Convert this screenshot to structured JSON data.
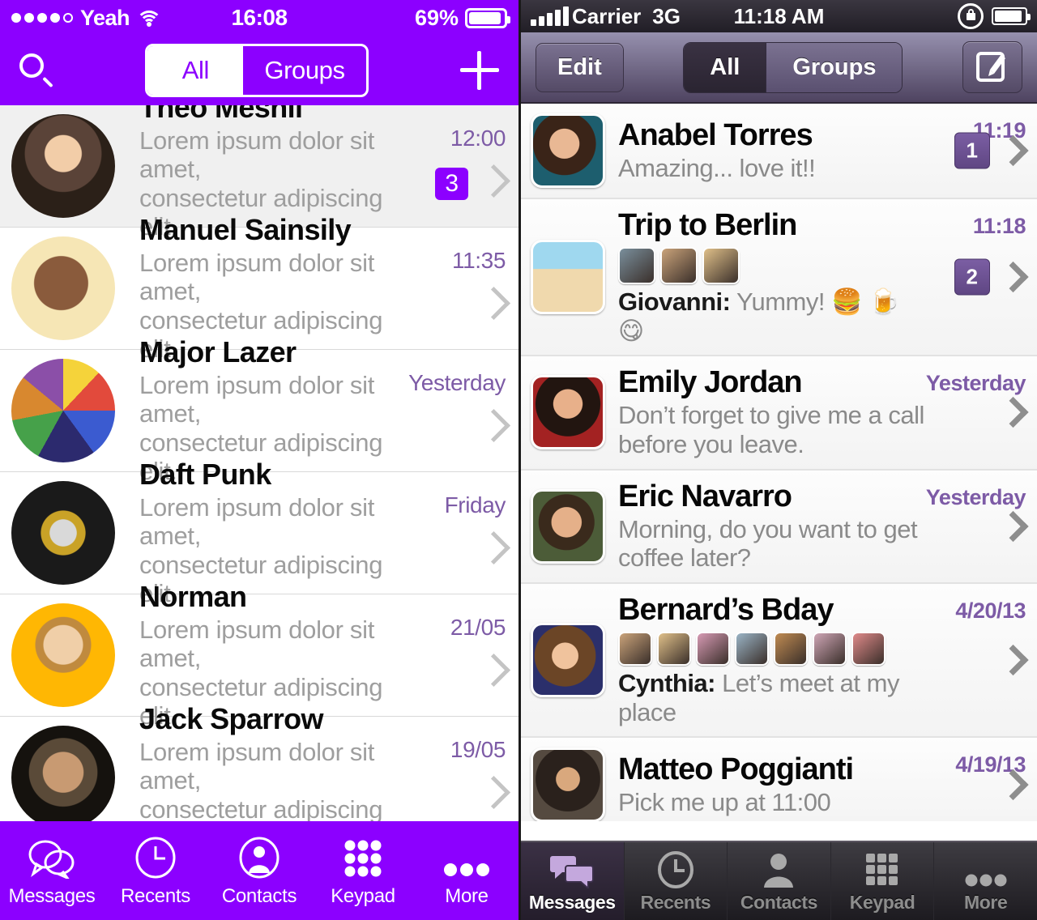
{
  "left_phone": {
    "style_name": "ios7-flat",
    "accent_color": "#8c00ff",
    "timestamp_color": "#7d5ba6",
    "status_bar": {
      "carrier": "Yeah",
      "signal_dots": 5,
      "signal_filled": 4,
      "wifi": "wifi-icon",
      "time": "16:08",
      "battery_percent": "69%"
    },
    "nav": {
      "search_icon": "search-icon",
      "add_icon": "plus-icon",
      "segments": [
        {
          "label": "All",
          "selected": false
        },
        {
          "label": "Groups",
          "selected": true
        }
      ]
    },
    "conversations": [
      {
        "name": "Théo Mesnil",
        "preview_line1": "Lorem ipsum dolor sit amet,",
        "preview_line2": "consectetur adipiscing elit.",
        "time": "12:00",
        "badge": "3",
        "selected": true
      },
      {
        "name": "Manuel Sainsily",
        "preview_line1": "Lorem ipsum dolor sit amet,",
        "preview_line2": "consectetur adipiscing elit.",
        "time": "11:35",
        "badge": "",
        "selected": false
      },
      {
        "name": "Major Lazer",
        "preview_line1": "Lorem ipsum dolor sit amet,",
        "preview_line2": "consectetur adipiscing elit.",
        "time": "Yesterday",
        "badge": "",
        "selected": false
      },
      {
        "name": "Daft Punk",
        "preview_line1": "Lorem ipsum dolor sit amet,",
        "preview_line2": "consectetur adipiscing elit.",
        "time": "Friday",
        "badge": "",
        "selected": false
      },
      {
        "name": "Norman",
        "preview_line1": "Lorem ipsum dolor sit amet,",
        "preview_line2": "consectetur adipiscing elit.",
        "time": "21/05",
        "badge": "",
        "selected": false
      },
      {
        "name": "Jack Sparrow",
        "preview_line1": "Lorem ipsum dolor sit amet,",
        "preview_line2": "consectetur adipiscing elit.",
        "time": "19/05",
        "badge": "",
        "selected": false
      }
    ],
    "tabs": [
      {
        "label": "Messages",
        "icon": "chat-bubbles-icon",
        "selected": true
      },
      {
        "label": "Recents",
        "icon": "clock-icon",
        "selected": false
      },
      {
        "label": "Contacts",
        "icon": "person-icon",
        "selected": false
      },
      {
        "label": "Keypad",
        "icon": "keypad-icon",
        "selected": false
      },
      {
        "label": "More",
        "icon": "ellipsis-icon",
        "selected": false
      }
    ]
  },
  "right_phone": {
    "style_name": "ios6-skeuomorphic",
    "accent_color": "#6b4f93",
    "timestamp_color": "#7d5ba6",
    "status_bar": {
      "carrier": "Carrier",
      "network": "3G",
      "signal_bars": 5,
      "time": "11:18 AM",
      "lock_icon": "rotation-lock-icon",
      "battery_icon": "battery-icon"
    },
    "nav": {
      "edit_label": "Edit",
      "compose_icon": "compose-icon",
      "segments": [
        {
          "label": "All",
          "selected": true
        },
        {
          "label": "Groups",
          "selected": false
        }
      ]
    },
    "conversations": [
      {
        "name": "Anabel Torres",
        "preview": "Amazing... love it!!",
        "sender": "",
        "time": "11:19",
        "badge": "1",
        "group_avatars": 0
      },
      {
        "name": "Trip to Berlin",
        "preview": "Yummy! 🍔 🍺 😋",
        "sender": "Giovanni:",
        "time": "11:18",
        "badge": "2",
        "group_avatars": 3
      },
      {
        "name": "Emily Jordan",
        "preview": "Don’t forget to give me a call before you leave.",
        "sender": "",
        "time": "Yesterday",
        "badge": "",
        "group_avatars": 0
      },
      {
        "name": "Eric Navarro",
        "preview": "Morning, do you want to get coffee later?",
        "sender": "",
        "time": "Yesterday",
        "badge": "",
        "group_avatars": 0
      },
      {
        "name": "Bernard’s Bday",
        "preview": "Let’s meet at my place",
        "sender": "Cynthia:",
        "time": "4/20/13",
        "badge": "",
        "group_avatars": 7
      },
      {
        "name": "Matteo Poggianti",
        "preview": "Pick me up at 11:00",
        "sender": "",
        "time": "4/19/13",
        "badge": "",
        "group_avatars": 0
      }
    ],
    "tabs": [
      {
        "label": "Messages",
        "icon": "chat-bubbles-icon",
        "selected": true
      },
      {
        "label": "Recents",
        "icon": "clock-icon",
        "selected": false
      },
      {
        "label": "Contacts",
        "icon": "person-icon",
        "selected": false
      },
      {
        "label": "Keypad",
        "icon": "keypad-icon",
        "selected": false
      },
      {
        "label": "More",
        "icon": "ellipsis-icon",
        "selected": false
      }
    ]
  }
}
